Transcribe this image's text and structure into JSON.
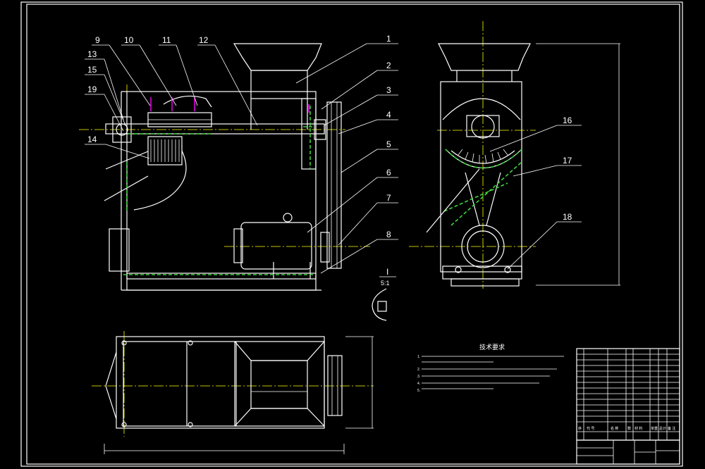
{
  "drawing": {
    "background": "#000000",
    "line_color": "#ffffff",
    "centerline_color": "#ffff00",
    "hidden_line_color": "#3cd23c",
    "bolt_color": "#ff00ff"
  },
  "balloons": {
    "b1": "1",
    "b2": "2",
    "b3": "3",
    "b4": "4",
    "b5": "5",
    "b6": "6",
    "b7": "7",
    "b8": "8",
    "b9": "9",
    "b10": "10",
    "b11": "11",
    "b12": "12",
    "b13": "13",
    "b14": "14",
    "b15": "15",
    "b16": "16",
    "b17": "17",
    "b18": "18",
    "b19": "19"
  },
  "detail": {
    "label": "I",
    "scale": "5:1"
  },
  "tech_req": {
    "title": "技术要求",
    "lines": [
      "1. ",
      "",
      "2. ",
      "3. ",
      "4. ",
      "5. "
    ]
  },
  "title_block": {
    "heads": [
      "序",
      "代 号",
      "名 称",
      "数",
      "材 料",
      "单重",
      "总计",
      "备 注"
    ],
    "name": "",
    "code": ""
  }
}
